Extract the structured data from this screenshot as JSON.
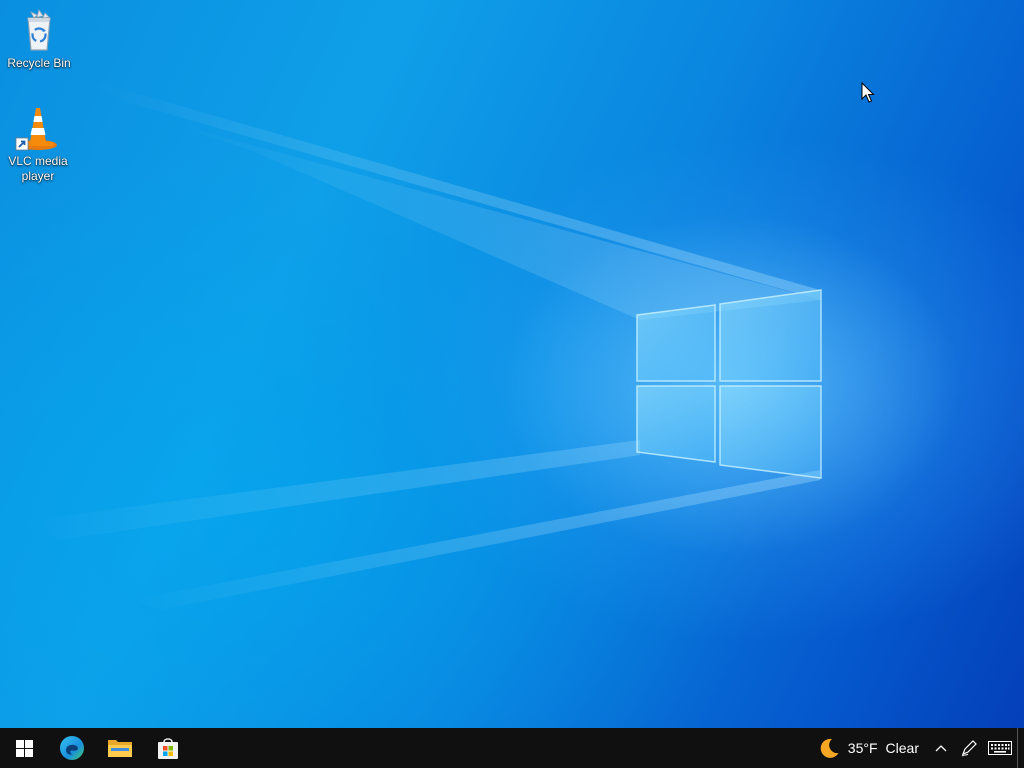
{
  "desktop": {
    "icons": [
      {
        "label": "Recycle Bin",
        "icon": "recycle-bin-icon"
      },
      {
        "label": "VLC media player",
        "icon": "vlc-cone-icon"
      }
    ]
  },
  "taskbar": {
    "pinned": [
      {
        "name": "start",
        "icon": "windows-logo-icon"
      },
      {
        "name": "microsoft-edge",
        "icon": "edge-icon"
      },
      {
        "name": "file-explorer",
        "icon": "folder-icon"
      },
      {
        "name": "microsoft-store",
        "icon": "store-bag-icon"
      }
    ],
    "tray": {
      "weather_icon": "moon-icon",
      "temperature": "35°F",
      "condition": "Clear",
      "overflow_icon": "chevron-up-icon",
      "pen_icon": "pen-icon",
      "keyboard_icon": "keyboard-icon"
    }
  },
  "colors": {
    "taskbar": "#101010",
    "wallpaper_accent": "#0a86e0",
    "text": "#ffffff"
  }
}
